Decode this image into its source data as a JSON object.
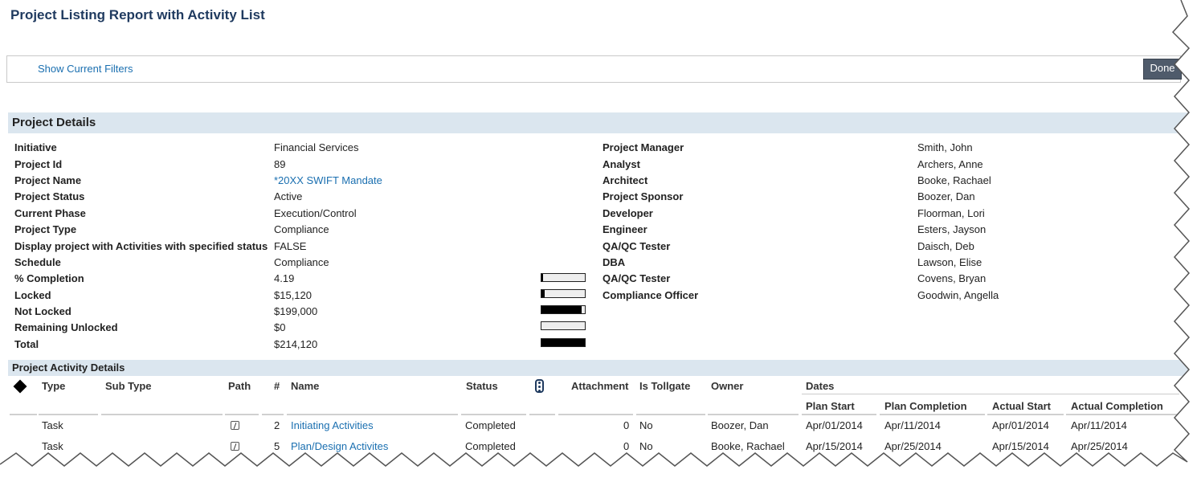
{
  "page": {
    "title": "Project Listing Report with Activity List"
  },
  "filters": {
    "show_label": "Show Current Filters",
    "done_label": "Done"
  },
  "project_details": {
    "header": "Project Details",
    "left": [
      {
        "label": "Initiative",
        "value": "Financial Services"
      },
      {
        "label": "Project Id",
        "value": "89"
      },
      {
        "label": "Project Name",
        "value": "*20XX SWIFT Mandate"
      },
      {
        "label": "Project Status",
        "value": "Active"
      },
      {
        "label": "Current Phase",
        "value": "Execution/Control"
      },
      {
        "label": "Project Type",
        "value": "Compliance"
      },
      {
        "label": "Display project with Activities with specified status",
        "value": "FALSE"
      },
      {
        "label": "Schedule",
        "value": "Compliance"
      },
      {
        "label": "% Completion",
        "value": "4.19"
      },
      {
        "label": "Locked",
        "value": "$15,120"
      },
      {
        "label": "Not Locked",
        "value": "$199,000"
      },
      {
        "label": "Remaining Unlocked",
        "value": "$0"
      },
      {
        "label": "Total",
        "value": "$214,120"
      }
    ],
    "bars": [
      {
        "name": "completion-bar",
        "fraction": 0.0419
      },
      {
        "name": "locked-bar",
        "fraction": 0.07
      },
      {
        "name": "not-locked-bar",
        "fraction": 0.93
      },
      {
        "name": "remaining-unlocked-bar",
        "fraction": 0.0
      },
      {
        "name": "total-bar",
        "fraction": 1.0
      }
    ],
    "right": [
      {
        "label": "Project Manager",
        "value": "Smith, John"
      },
      {
        "label": "Analyst",
        "value": "Archers, Anne"
      },
      {
        "label": "Architect",
        "value": "Booke, Rachael"
      },
      {
        "label": "Project Sponsor",
        "value": "Boozer, Dan"
      },
      {
        "label": "Developer",
        "value": "Floorman, Lori"
      },
      {
        "label": "Engineer",
        "value": "Esters, Jayson"
      },
      {
        "label": "QA/QC Tester",
        "value": "Daisch, Deb"
      },
      {
        "label": "DBA",
        "value": "Lawson, Elise"
      },
      {
        "label": "QA/QC Tester",
        "value": "Covens, Bryan"
      },
      {
        "label": "Compliance Officer",
        "value": "Goodwin, Angella"
      }
    ]
  },
  "activity_details": {
    "header": "Project Activity Details",
    "columns": {
      "type": "Type",
      "sub_type": "Sub Type",
      "path": "Path",
      "num": "#",
      "name": "Name",
      "status": "Status",
      "attachment": "Attachment",
      "is_tollgate": "Is Tollgate",
      "owner": "Owner",
      "dates": "Dates",
      "plan_start": "Plan Start",
      "plan_completion": "Plan Completion",
      "actual_start": "Actual Start",
      "actual_completion": "Actual Completion"
    },
    "rows": [
      {
        "type": "Task",
        "sub_type": "",
        "num": "2",
        "name": "Initiating Activities",
        "status": "Completed",
        "attachment": "0",
        "is_tollgate": "No",
        "owner": "Boozer, Dan",
        "plan_start": "Apr/01/2014",
        "plan_completion": "Apr/11/2014",
        "actual_start": "Apr/01/2014",
        "actual_completion": "Apr/11/2014"
      },
      {
        "type": "Task",
        "sub_type": "",
        "num": "5",
        "name": "Plan/Design Activites",
        "status": "Completed",
        "attachment": "0",
        "is_tollgate": "No",
        "owner": "Booke, Rachael",
        "plan_start": "Apr/15/2014",
        "plan_completion": "Apr/25/2014",
        "actual_start": "Apr/15/2014",
        "actual_completion": "Apr/25/2014"
      }
    ]
  }
}
